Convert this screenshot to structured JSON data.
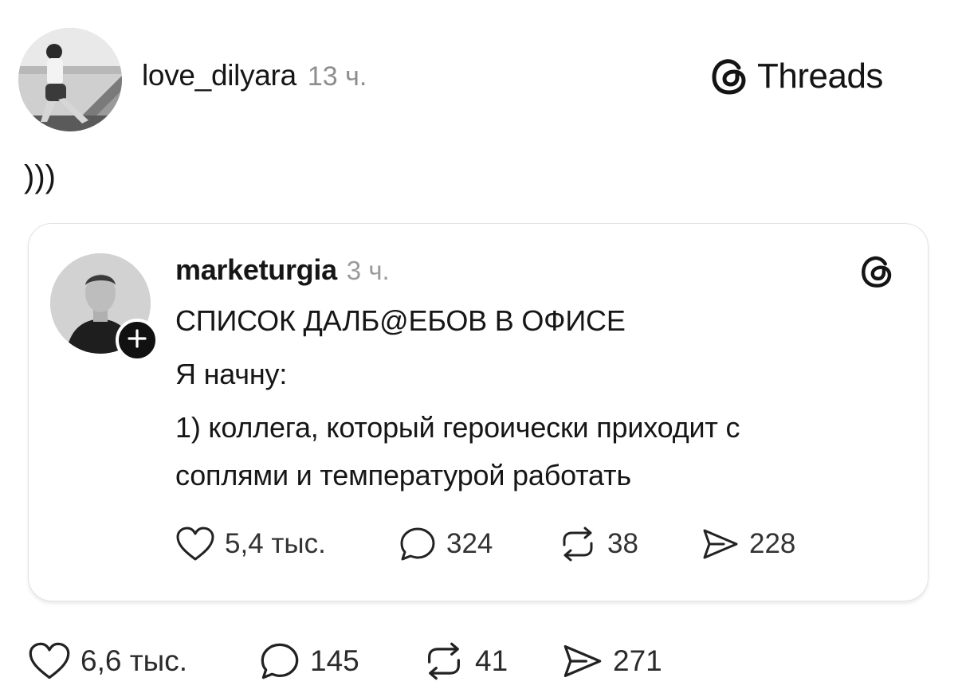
{
  "post": {
    "author": "love_dilyara",
    "time": "13 ч.",
    "brand": "Threads",
    "text": ")))",
    "stats": {
      "likes": "6,6 тыс.",
      "replies": "145",
      "reposts": "41",
      "shares": "271"
    }
  },
  "quoted": {
    "author": "marketurgia",
    "time": "3 ч.",
    "lines": [
      "СПИСОК ДАЛБ@ЕБОВ В ОФИСЕ",
      "Я начну:",
      "1) коллега, который героически приходит с",
      "соплями и температурой работать"
    ],
    "stats": {
      "likes": "5,4 тыс.",
      "replies": "324",
      "reposts": "38",
      "shares": "228"
    }
  },
  "icons": {
    "brand": "threads-logo-icon",
    "like": "heart-icon",
    "reply": "comment-bubble-icon",
    "repost": "repost-arrows-icon",
    "share": "send-paper-plane-icon",
    "follow": "plus-icon"
  },
  "colors": {
    "text": "#161616",
    "muted": "#8e8e8e",
    "card_border": "#e2e2e2",
    "badge": "#111111"
  }
}
